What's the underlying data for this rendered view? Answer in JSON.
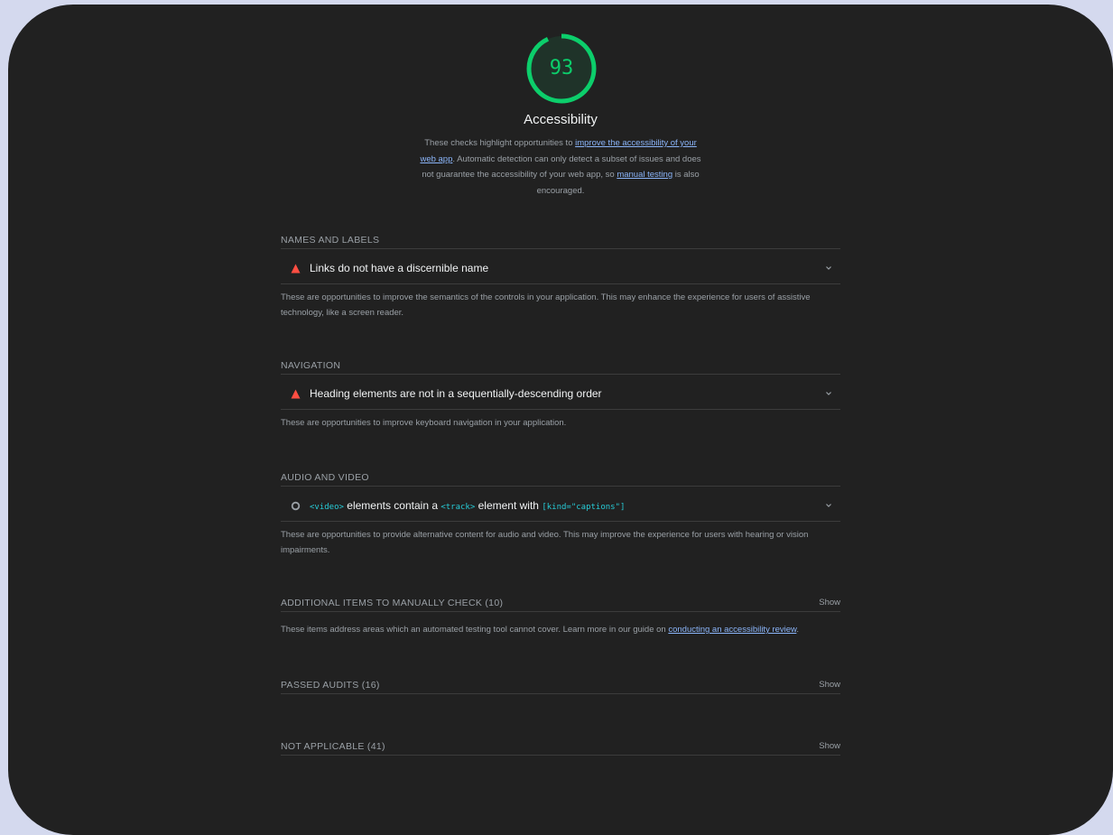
{
  "category": {
    "score": "93",
    "title": "Accessibility",
    "description": {
      "part1": "These checks highlight opportunities to ",
      "link1": "improve the accessibility of your web app",
      "part2": ". Automatic detection can only detect a subset of issues and does not guarantee the accessibility of your web app, so ",
      "link2": "manual testing",
      "part3": " is also encouraged."
    },
    "colors": {
      "pass": "#0cce6b",
      "fail": "#ff4e42",
      "background": "#212121",
      "link": "#8ab4f8"
    }
  },
  "groups": {
    "names_labels": {
      "title": "NAMES AND LABELS",
      "audit": "Links do not have a discernible name",
      "description": "These are opportunities to improve the semantics of the controls in your application. This may enhance the experience for users of assistive technology, like a screen reader."
    },
    "navigation": {
      "title": "NAVIGATION",
      "audit": "Heading elements are not in a sequentially-descending order",
      "description": "These are opportunities to improve keyboard navigation in your application."
    },
    "audio_video": {
      "title": "AUDIO AND VIDEO",
      "audit_code1": "<video>",
      "audit_text1": " elements contain a ",
      "audit_code2": "<track>",
      "audit_text2": " element with ",
      "audit_code3": "[kind=\"captions\"]",
      "description": "These are opportunities to provide alternative content for audio and video. This may improve the experience for users with hearing or vision impairments."
    },
    "manual": {
      "title": "ADDITIONAL ITEMS TO MANUALLY CHECK (10)",
      "show": "Show",
      "description": "These items address areas which an automated testing tool cannot cover. Learn more in our guide on ",
      "link": "conducting an accessibility review",
      "end": "."
    },
    "passed": {
      "title": "PASSED AUDITS (16)",
      "show": "Show"
    },
    "not_applicable": {
      "title": "NOT APPLICABLE (41)",
      "show": "Show"
    }
  }
}
